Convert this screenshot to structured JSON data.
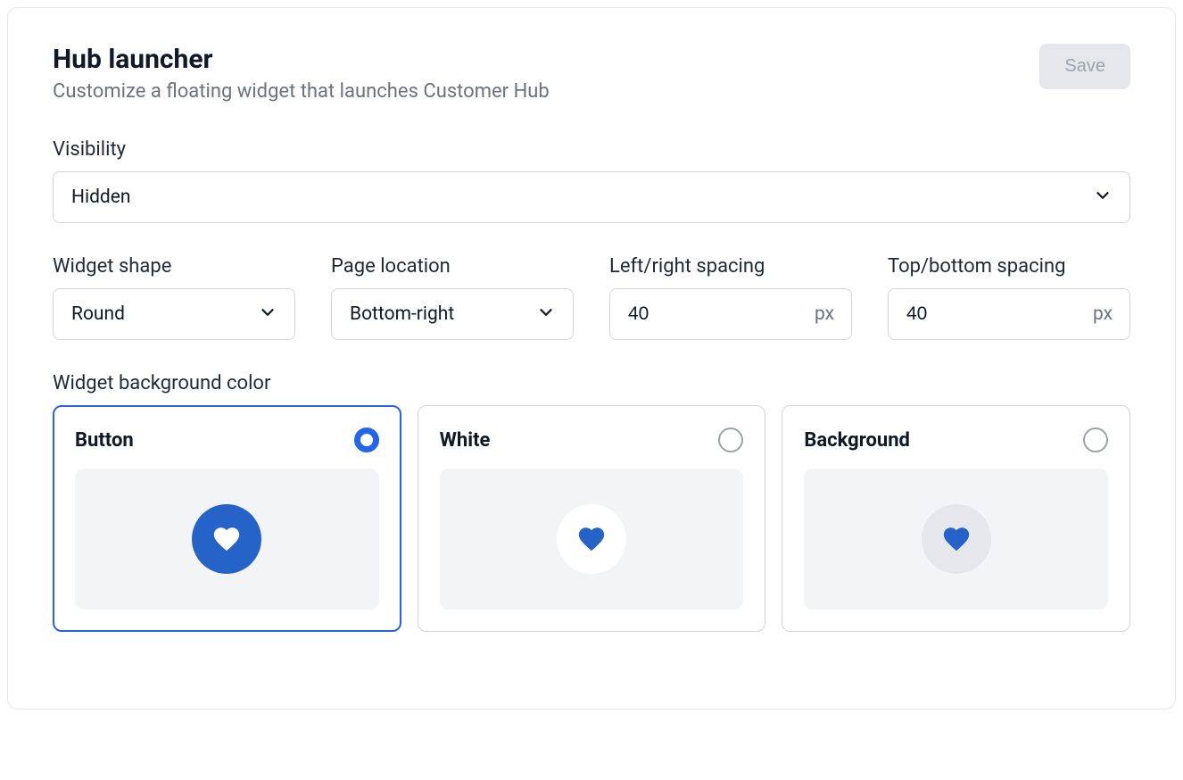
{
  "header": {
    "title": "Hub launcher",
    "subtitle": "Customize a floating widget that launches Customer Hub",
    "saveLabel": "Save"
  },
  "visibility": {
    "label": "Visibility",
    "value": "Hidden"
  },
  "widgetShape": {
    "label": "Widget shape",
    "value": "Round"
  },
  "pageLocation": {
    "label": "Page location",
    "value": "Bottom-right"
  },
  "leftRightSpacing": {
    "label": "Left/right spacing",
    "value": "40",
    "unit": "px"
  },
  "topBottomSpacing": {
    "label": "Top/bottom spacing",
    "value": "40",
    "unit": "px"
  },
  "widgetBgColor": {
    "label": "Widget background color",
    "options": [
      {
        "label": "Button",
        "selected": true,
        "circleClass": "blue",
        "heartClass": "heart-white"
      },
      {
        "label": "White",
        "selected": false,
        "circleClass": "white",
        "heartClass": "heart-blue"
      },
      {
        "label": "Background",
        "selected": false,
        "circleClass": "gray",
        "heartClass": "heart-blue"
      }
    ]
  }
}
